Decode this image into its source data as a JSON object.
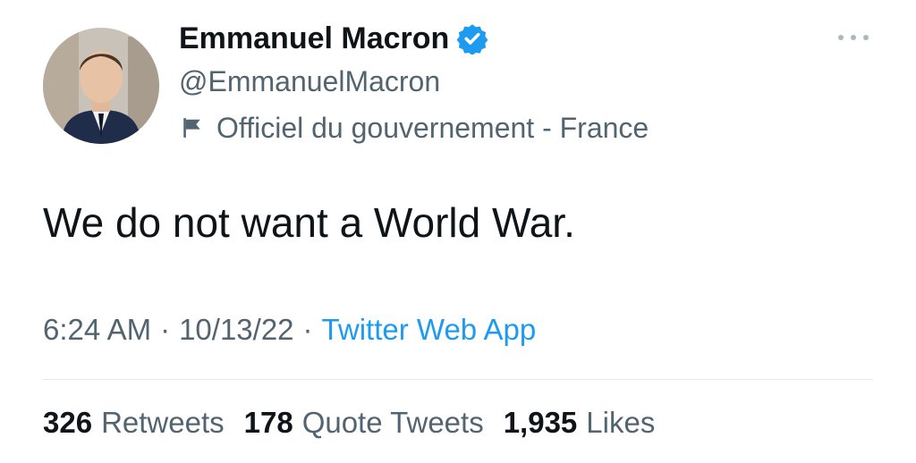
{
  "author": {
    "display_name": "Emmanuel Macron",
    "handle": "@EmmanuelMacron",
    "verified": true,
    "label": "Officiel du gouvernement - France",
    "label_icon": "flag-icon",
    "avatar": "profile-photo"
  },
  "tweet": {
    "text": "We do not want a World War.",
    "time": "6:24 AM",
    "separator": "·",
    "date": "10/13/22",
    "source": "Twitter Web App"
  },
  "stats": {
    "retweets_count": "326",
    "retweets_label": "Retweets",
    "quotes_count": "178",
    "quotes_label": "Quote Tweets",
    "likes_count": "1,935",
    "likes_label": "Likes"
  },
  "colors": {
    "text_primary": "#0f1419",
    "text_secondary": "#536471",
    "accent": "#1d9bf0",
    "divider": "#e1e8ed"
  },
  "icons": {
    "verified": "verified-badge-icon",
    "more": "more-options-icon"
  }
}
